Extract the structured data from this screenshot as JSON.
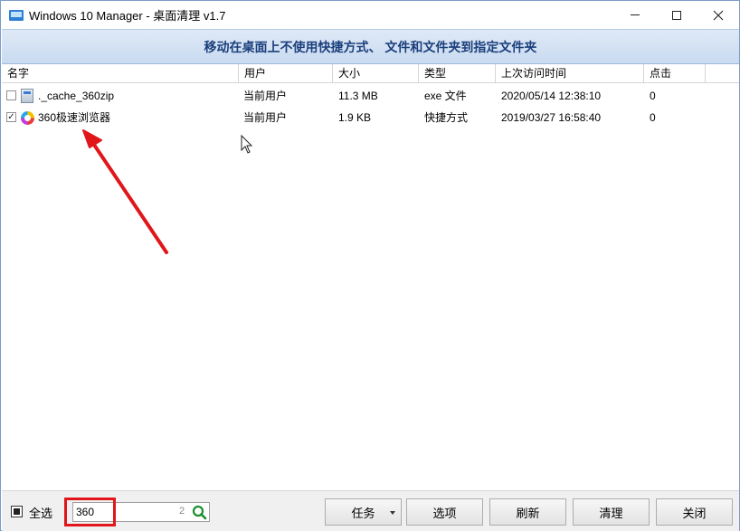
{
  "window": {
    "title": "Windows 10 Manager - 桌面清理 v1.7"
  },
  "banner": {
    "text": "移动在桌面上不使用快捷方式、 文件和文件夹到指定文件夹"
  },
  "table": {
    "columns": [
      "名字",
      "用户",
      "大小",
      "类型",
      "上次访问时间",
      "点击"
    ],
    "rows": [
      {
        "checked": false,
        "icon": "exe-file-icon",
        "name": "._cache_360zip",
        "user": "当前用户",
        "size": "11.3 MB",
        "type": "exe 文件",
        "last_access": "2020/05/14 12:38:10",
        "clicks": "0"
      },
      {
        "checked": true,
        "icon": "browser-icon",
        "name": "360极速浏览器",
        "user": "当前用户",
        "size": "1.9 KB",
        "type": "快捷方式",
        "last_access": "2019/03/27 16:58:40",
        "clicks": "0"
      }
    ]
  },
  "bottom": {
    "select_all_label": "全选",
    "search_value": "360",
    "search_count": "2",
    "buttons": {
      "task": "任务",
      "options": "选项",
      "refresh": "刷新",
      "clean": "清理",
      "close": "关闭"
    }
  },
  "colors": {
    "banner_text": "#1b3f7c",
    "highlight": "#e0161b"
  }
}
